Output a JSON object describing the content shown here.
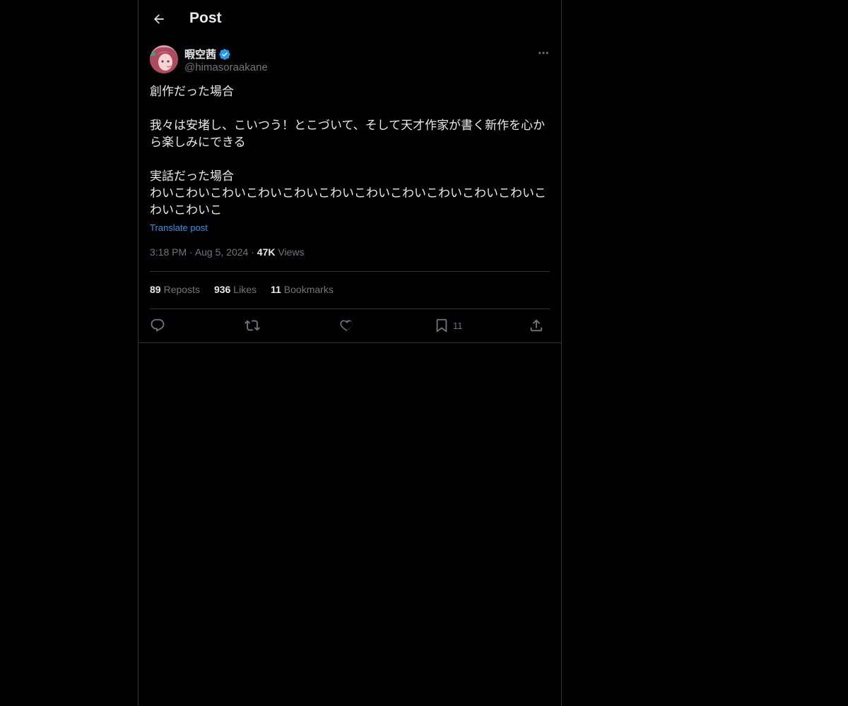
{
  "header": {
    "title": "Post"
  },
  "author": {
    "display_name": "暇空茜",
    "handle": "@himasoraakane",
    "verified": true
  },
  "post": {
    "lines": [
      "創作だった場合",
      "",
      "我々は安堵し、こいつう！とこづいて、そして天才作家が書く新作を心から楽しみにできる",
      "",
      "実話だった場合",
      "わいこわいこわいこわいこわいこわいこわいこわいこわいこわいこわいこわいこわいこ"
    ],
    "translate_label": "Translate post",
    "time": "3:18 PM",
    "date": "Aug 5, 2024",
    "views_count": "47K",
    "views_label": "Views"
  },
  "stats": {
    "reposts_count": "89",
    "reposts_label": "Reposts",
    "likes_count": "936",
    "likes_label": "Likes",
    "bookmarks_count": "11",
    "bookmarks_label": "Bookmarks"
  },
  "actions": {
    "bookmark_count": "11"
  },
  "colors": {
    "background": "#000000",
    "text": "#e7e9ea",
    "muted": "#71767b",
    "accent": "#1d9bf0",
    "border": "#2f3336"
  },
  "icons": [
    "back-arrow-icon",
    "verified-badge-icon",
    "more-icon",
    "reply-icon",
    "repost-icon",
    "like-icon",
    "bookmark-icon",
    "share-icon"
  ]
}
